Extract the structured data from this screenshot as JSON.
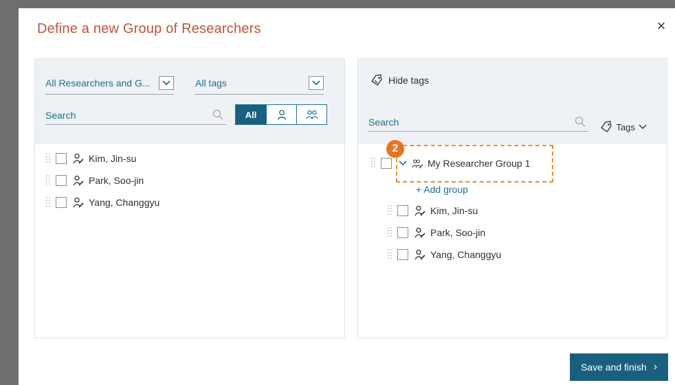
{
  "dialog": {
    "title": "Define a new Group of Researchers",
    "close_symbol": "×"
  },
  "left": {
    "researchers_filter": "All Researchers and G...",
    "tags_filter": "All tags",
    "search_placeholder": "Search",
    "segment": {
      "all_label": "All",
      "person_icon": "person-icon",
      "people_icon": "people-icon"
    },
    "items": [
      {
        "name": "Kim, Jin-su"
      },
      {
        "name": "Park, Soo-jin"
      },
      {
        "name": "Yang, Changgyu"
      }
    ]
  },
  "right": {
    "hide_tags_label": "Hide tags",
    "search_placeholder": "Search",
    "tags_label": "Tags",
    "group": {
      "name": "My Researcher Group 1",
      "badge": "2"
    },
    "add_group_label": "+ Add group",
    "members": [
      {
        "name": "Kim, Jin-su"
      },
      {
        "name": "Park, Soo-jin"
      },
      {
        "name": "Yang, Changgyu"
      }
    ]
  },
  "footer": {
    "save_label": "Save and finish",
    "save_chevron": "›"
  },
  "colors": {
    "title": "#c0533a",
    "accent": "#1b5f80",
    "link": "#1f6e94",
    "highlight": "#e98e2a"
  }
}
